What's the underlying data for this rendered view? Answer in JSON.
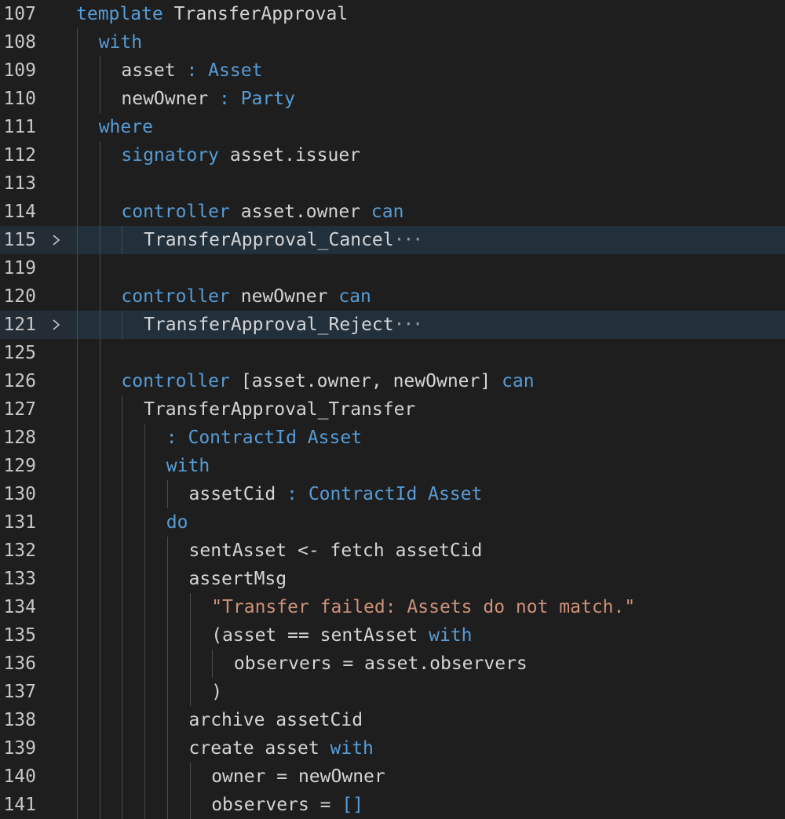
{
  "colors": {
    "background": "#1e1e1e",
    "line_number": "#c8c8c8",
    "keyword": "#569cd6",
    "identifier": "#d4d4d4",
    "string": "#ce9178",
    "folded_line_highlight": "#242c36",
    "indent_guide": "#4a4a4a"
  },
  "icons": {
    "fold_toggle": "chevron-right-icon",
    "fold_ellipsis": "ellipsis-icon"
  },
  "lines": [
    {
      "n": "107",
      "indent": 0,
      "tokens": [
        [
          "k",
          "template"
        ],
        [
          "t",
          " TransferApproval"
        ]
      ]
    },
    {
      "n": "108",
      "indent": 1,
      "tokens": [
        [
          "k",
          "with"
        ]
      ]
    },
    {
      "n": "109",
      "indent": 2,
      "tokens": [
        [
          "t",
          "asset "
        ],
        [
          "k",
          ": Asset"
        ]
      ]
    },
    {
      "n": "110",
      "indent": 2,
      "tokens": [
        [
          "t",
          "newOwner "
        ],
        [
          "k",
          ": Party"
        ]
      ]
    },
    {
      "n": "111",
      "indent": 1,
      "tokens": [
        [
          "k",
          "where"
        ]
      ]
    },
    {
      "n": "112",
      "indent": 2,
      "tokens": [
        [
          "k",
          "signatory"
        ],
        [
          "t",
          " asset.issuer"
        ]
      ]
    },
    {
      "n": "113",
      "indent": 2,
      "tokens": []
    },
    {
      "n": "114",
      "indent": 2,
      "tokens": [
        [
          "k",
          "controller"
        ],
        [
          "t",
          " asset.owner "
        ],
        [
          "k",
          "can"
        ]
      ]
    },
    {
      "n": "115",
      "indent": 3,
      "folded": true,
      "tokens": [
        [
          "t",
          "TransferApproval_Cancel"
        ],
        [
          "e",
          "···"
        ]
      ]
    },
    {
      "n": "119",
      "indent": 2,
      "tokens": []
    },
    {
      "n": "120",
      "indent": 2,
      "tokens": [
        [
          "k",
          "controller"
        ],
        [
          "t",
          " newOwner "
        ],
        [
          "k",
          "can"
        ]
      ]
    },
    {
      "n": "121",
      "indent": 3,
      "folded": true,
      "tokens": [
        [
          "t",
          "TransferApproval_Reject"
        ],
        [
          "e",
          "···"
        ]
      ]
    },
    {
      "n": "125",
      "indent": 2,
      "tokens": []
    },
    {
      "n": "126",
      "indent": 2,
      "tokens": [
        [
          "k",
          "controller"
        ],
        [
          "t",
          " [asset.owner, newOwner] "
        ],
        [
          "k",
          "can"
        ]
      ]
    },
    {
      "n": "127",
      "indent": 3,
      "tokens": [
        [
          "t",
          "TransferApproval_Transfer"
        ]
      ]
    },
    {
      "n": "128",
      "indent": 4,
      "tokens": [
        [
          "k",
          ": ContractId Asset"
        ]
      ]
    },
    {
      "n": "129",
      "indent": 4,
      "tokens": [
        [
          "k",
          "with"
        ]
      ]
    },
    {
      "n": "130",
      "indent": 5,
      "tokens": [
        [
          "t",
          "assetCid "
        ],
        [
          "k",
          ": ContractId Asset"
        ]
      ]
    },
    {
      "n": "131",
      "indent": 4,
      "tokens": [
        [
          "k",
          "do"
        ]
      ]
    },
    {
      "n": "132",
      "indent": 5,
      "tokens": [
        [
          "t",
          "sentAsset <- fetch assetCid"
        ]
      ]
    },
    {
      "n": "133",
      "indent": 5,
      "tokens": [
        [
          "t",
          "assertMsg"
        ]
      ]
    },
    {
      "n": "134",
      "indent": 6,
      "tokens": [
        [
          "s",
          "\"Transfer failed: Assets do not match.\""
        ]
      ]
    },
    {
      "n": "135",
      "indent": 6,
      "tokens": [
        [
          "t",
          "(asset == sentAsset "
        ],
        [
          "k",
          "with"
        ]
      ]
    },
    {
      "n": "136",
      "indent": 7,
      "tokens": [
        [
          "t",
          "observers = asset.observers"
        ]
      ]
    },
    {
      "n": "137",
      "indent": 6,
      "tokens": [
        [
          "t",
          ")"
        ]
      ]
    },
    {
      "n": "138",
      "indent": 5,
      "tokens": [
        [
          "t",
          "archive assetCid"
        ]
      ]
    },
    {
      "n": "139",
      "indent": 5,
      "tokens": [
        [
          "t",
          "create asset "
        ],
        [
          "k",
          "with"
        ]
      ]
    },
    {
      "n": "140",
      "indent": 6,
      "tokens": [
        [
          "t",
          "owner = newOwner"
        ]
      ]
    },
    {
      "n": "141",
      "indent": 6,
      "tokens": [
        [
          "t",
          "observers = "
        ],
        [
          "k",
          "[]"
        ]
      ]
    }
  ]
}
